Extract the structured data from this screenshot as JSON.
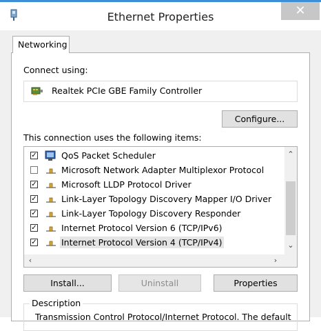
{
  "window": {
    "title": "Ethernet Properties",
    "close_glyph": "✕"
  },
  "tab": {
    "label": "Networking"
  },
  "connect": {
    "label": "Connect using:",
    "adapter": "Realtek PCIe GBE Family Controller"
  },
  "buttons": {
    "configure": "Configure...",
    "install": "Install...",
    "uninstall": "Uninstall",
    "properties": "Properties"
  },
  "items": {
    "label": "This connection uses the following items:",
    "list": [
      {
        "label": "QoS Packet Scheduler",
        "checked": true,
        "icon": "qos-icon"
      },
      {
        "label": "Microsoft Network Adapter Multiplexor Protocol",
        "checked": false,
        "icon": "protocol-icon"
      },
      {
        "label": "Microsoft LLDP Protocol Driver",
        "checked": true,
        "icon": "protocol-icon"
      },
      {
        "label": "Link-Layer Topology Discovery Mapper I/O Driver",
        "checked": true,
        "icon": "protocol-icon"
      },
      {
        "label": "Link-Layer Topology Discovery Responder",
        "checked": true,
        "icon": "protocol-icon"
      },
      {
        "label": "Internet Protocol Version 6 (TCP/IPv6)",
        "checked": true,
        "icon": "protocol-icon"
      },
      {
        "label": "Internet Protocol Version 4 (TCP/IPv4)",
        "checked": true,
        "icon": "protocol-icon",
        "selected": true
      }
    ]
  },
  "description": {
    "title": "Description",
    "text": "Transmission Control Protocol/Internet Protocol. The default"
  },
  "colors": {
    "accent": "#3c8fd6",
    "close": "#c7c7c7",
    "selection": "#e5e5e5"
  }
}
